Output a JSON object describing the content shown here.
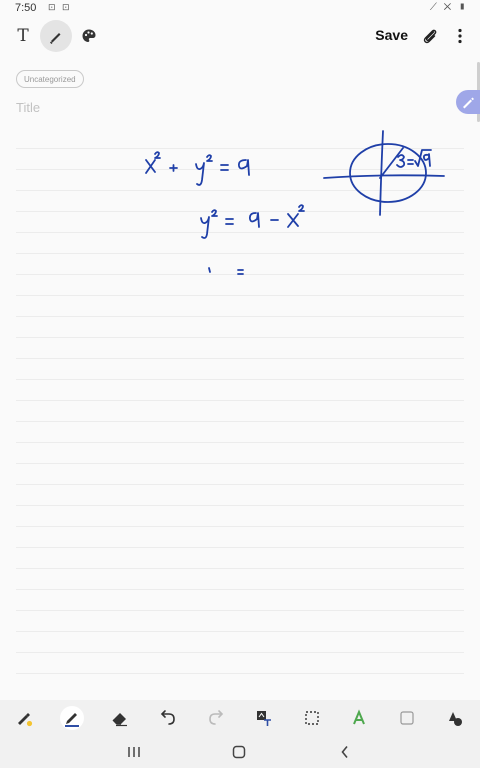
{
  "status": {
    "time": "7:50",
    "left_icons": "⊡ ⊡",
    "right_icons": "⟋ ✕ ▮"
  },
  "toolbar": {
    "save_label": "Save"
  },
  "note": {
    "category": "Uncategorized",
    "title_placeholder": "Title"
  },
  "colors": {
    "ink": "#1f3fa8",
    "accent": "#9fa7e8",
    "active_pen": "#2f4ea5",
    "highlighter": "#4ea84e"
  }
}
